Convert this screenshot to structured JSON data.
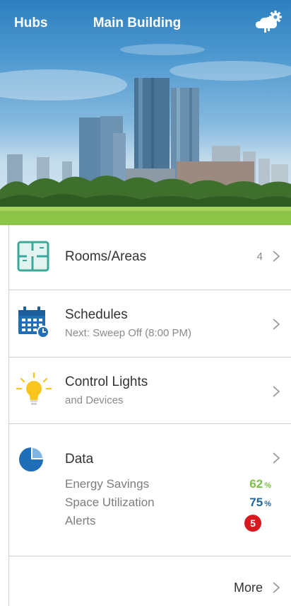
{
  "header": {
    "left_label": "Hubs",
    "title": "Main Building",
    "settings_icon": "cloud-gear-icon"
  },
  "menu": {
    "rooms": {
      "label": "Rooms/Areas",
      "count": "4",
      "icon": "floorplan-icon"
    },
    "schedules": {
      "label": "Schedules",
      "subtitle": "Next: Sweep Off (8:00 PM)",
      "icon": "calendar-clock-icon"
    },
    "lights": {
      "label": "Control Lights",
      "subtitle": "and Devices",
      "icon": "lightbulb-icon"
    },
    "data": {
      "label": "Data",
      "icon": "pie-chart-icon",
      "energy_label": "Energy Savings",
      "energy_value": "62",
      "utilization_label": "Space Utilization",
      "utilization_value": "75",
      "alerts_label": "Alerts",
      "alerts_count": "5",
      "percent_sign": "%"
    },
    "more_label": "More"
  },
  "colors": {
    "accent_teal": "#3aa89a",
    "accent_blue": "#1f6fb8",
    "light_yellow": "#f7c51e",
    "energy_green": "#7ac143",
    "utilization_blue": "#20659e",
    "alert_red": "#d71920"
  }
}
